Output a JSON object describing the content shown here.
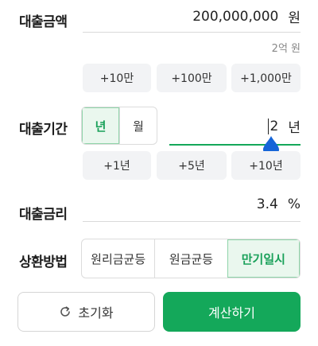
{
  "loan_amount": {
    "label": "대출금액",
    "value": "200,000,000",
    "unit": "원",
    "summary": "2억 원",
    "quick_add": [
      "+10만",
      "+100만",
      "+1,000만"
    ]
  },
  "loan_period": {
    "label": "대출기간",
    "unit_toggle": {
      "year_label": "년",
      "month_label": "월",
      "selected": "년"
    },
    "value": "2",
    "unit": "년",
    "slider_fraction": 0.0,
    "quick_add": [
      "+1년",
      "+5년",
      "+10년"
    ]
  },
  "interest_rate": {
    "label": "대출금리",
    "value": "3.4",
    "unit": "%"
  },
  "repayment": {
    "label": "상환방법",
    "options": [
      "원리금균등",
      "원금균등",
      "만기일시"
    ],
    "selected": "만기일시"
  },
  "actions": {
    "reset_label": "초기화",
    "calculate_label": "계산하기"
  },
  "colors": {
    "accent_green": "#14a85a",
    "slider_thumb": "#1565d8"
  }
}
